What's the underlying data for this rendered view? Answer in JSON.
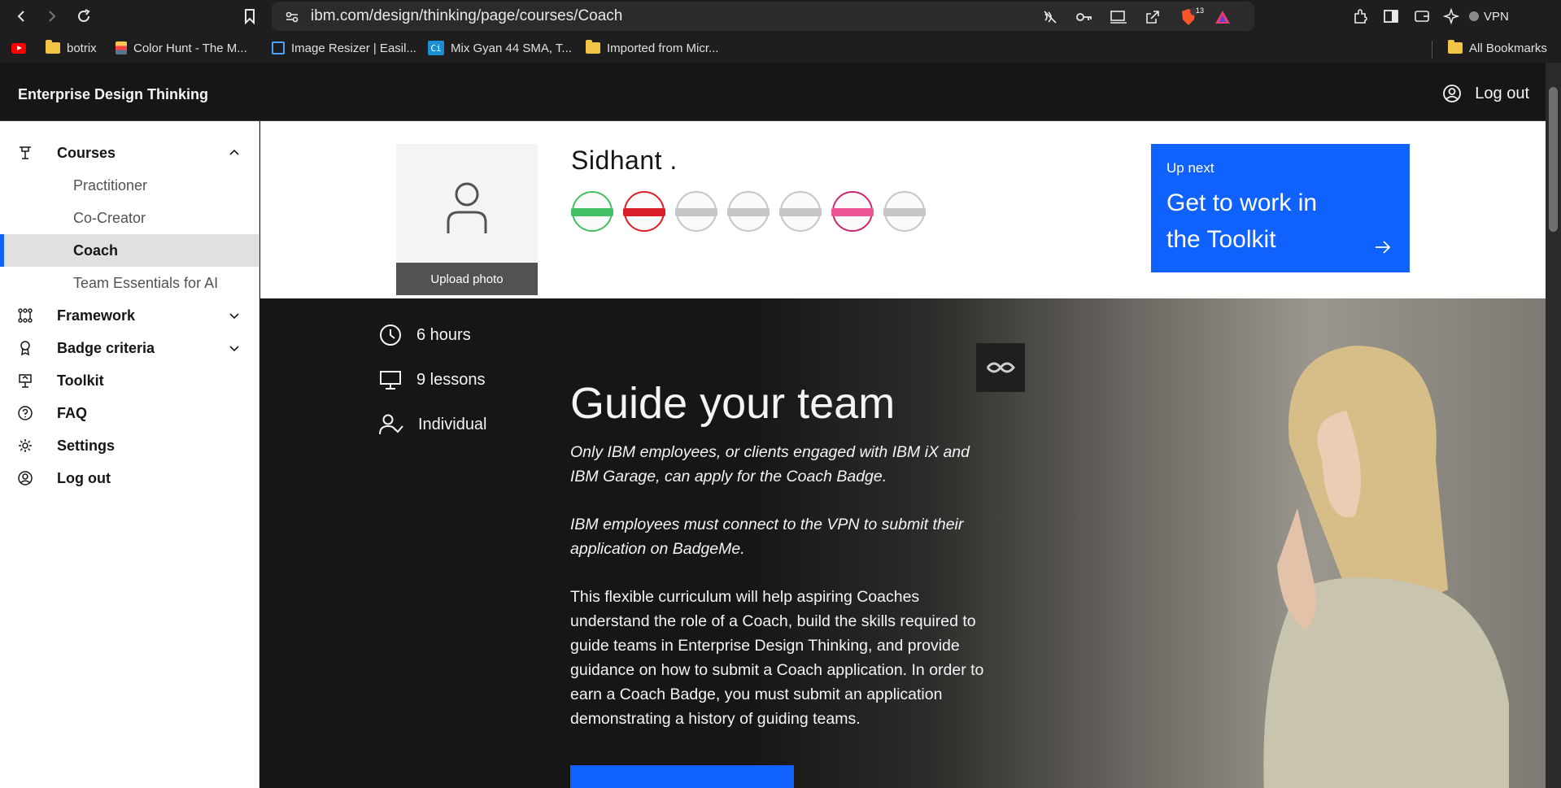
{
  "browser": {
    "url": "ibm.com/design/thinking/page/courses/Coach",
    "vpn_label": "VPN",
    "brave_badge_count": "13",
    "bookmarks": [
      {
        "label": "botrix",
        "icon": "folder-icon"
      },
      {
        "label": "Color Hunt - The M...",
        "icon": "color-hunt-icon"
      },
      {
        "label": "Image Resizer | Easil...",
        "icon": "image-resizer-icon"
      },
      {
        "label": "Mix Gyan 44 SMA, T...",
        "icon": "ci-icon"
      },
      {
        "label": "Imported from Micr...",
        "icon": "folder-icon"
      }
    ],
    "all_bookmarks_label": "All Bookmarks"
  },
  "header": {
    "brand": "Enterprise Design Thinking",
    "logout_label": "Log out"
  },
  "sidebar": {
    "items": [
      {
        "label": "Courses",
        "icon": "course-icon",
        "expanded": true
      },
      {
        "label": "Framework",
        "icon": "framework-icon",
        "expanded": false
      },
      {
        "label": "Badge criteria",
        "icon": "badge-icon",
        "expanded": false
      },
      {
        "label": "Toolkit",
        "icon": "toolkit-icon"
      },
      {
        "label": "FAQ",
        "icon": "help-icon"
      },
      {
        "label": "Settings",
        "icon": "settings-icon"
      },
      {
        "label": "Log out",
        "icon": "user-icon"
      }
    ],
    "courses": [
      {
        "label": "Practitioner",
        "active": false
      },
      {
        "label": "Co-Creator",
        "active": false
      },
      {
        "label": "Coach",
        "active": true
      },
      {
        "label": "Team Essentials for AI",
        "active": false
      }
    ]
  },
  "profile": {
    "name": "Sidhant .",
    "upload_label": "Upload photo",
    "badges": [
      {
        "name": "practitioner",
        "color": "#42be65"
      },
      {
        "name": "co-creator",
        "color": "#da1e28"
      },
      {
        "name": "coach",
        "color": "#c6c6c6"
      },
      {
        "name": "advocate",
        "color": "#c6c6c6"
      },
      {
        "name": "leader",
        "color": "#c6c6c6"
      },
      {
        "name": "team-essentials",
        "color": "#d02670"
      },
      {
        "name": "ai",
        "color": "#c6c6c6"
      }
    ]
  },
  "up_next": {
    "kicker": "Up next",
    "title": "Get to work in the Toolkit"
  },
  "course": {
    "duration": "6 hours",
    "lessons": "9 lessons",
    "mode": "Individual",
    "title": "Guide your team",
    "note1": "Only IBM employees, or clients engaged with IBM iX and IBM Garage, can apply for the Coach Badge.",
    "note2": "IBM employees must connect to the VPN to submit their application on BadgeMe.",
    "description": "This flexible curriculum will help aspiring Coaches understand the role of a Coach, build the skills required to guide teams in Enterprise Design Thinking, and provide guidance on how to submit a Coach application. In order to earn a Coach Badge, you must submit an application demonstrating a history of guiding teams."
  },
  "colors": {
    "accent": "#0f62fe",
    "dark": "#161616"
  }
}
